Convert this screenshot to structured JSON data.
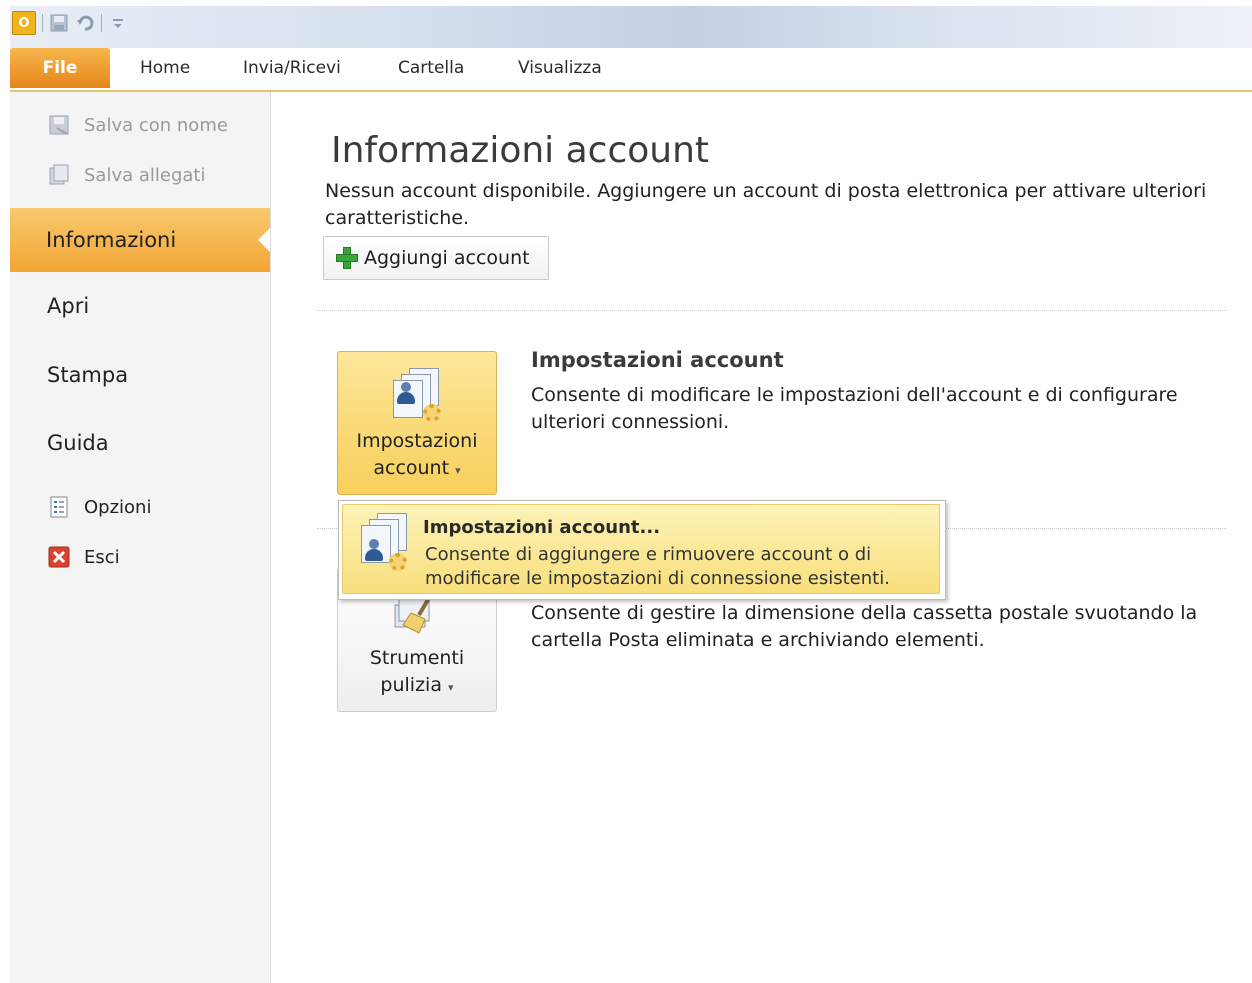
{
  "ribbon": {
    "tabs": [
      "File",
      "Home",
      "Invia/Ricevi",
      "Cartella",
      "Visualizza"
    ]
  },
  "leftnav": {
    "save_as": "Salva con nome",
    "save_attachments": "Salva allegati",
    "info": "Informazioni",
    "open": "Apri",
    "print": "Stampa",
    "help": "Guida",
    "options": "Opzioni",
    "exit": "Esci"
  },
  "main": {
    "title": "Informazioni account",
    "subtitle": "Nessun account disponibile. Aggiungere un account di posta elettronica per attivare ulteriori caratteristiche.",
    "add_account": "Aggiungi account",
    "account_settings": {
      "button_line1": "Impostazioni",
      "button_line2": "account",
      "title": "Impostazioni account",
      "description": "Consente di modificare le impostazioni dell'account e di configurare ulteriori connessioni."
    },
    "cleanup": {
      "button_line1": "Strumenti",
      "button_line2": "pulizia",
      "description": "Consente di gestire la dimensione della cassetta postale svuotando la cartella Posta eliminata e archiviando elementi."
    }
  },
  "dropdown": {
    "item_title": "Impostazioni account...",
    "item_description": "Consente di aggiungere e rimuovere account o di modificare le impostazioni di connessione esistenti."
  },
  "icons": {
    "app": "outlook-icon",
    "save": "save-icon",
    "undo": "undo-icon",
    "customize": "customize-qat-icon"
  }
}
